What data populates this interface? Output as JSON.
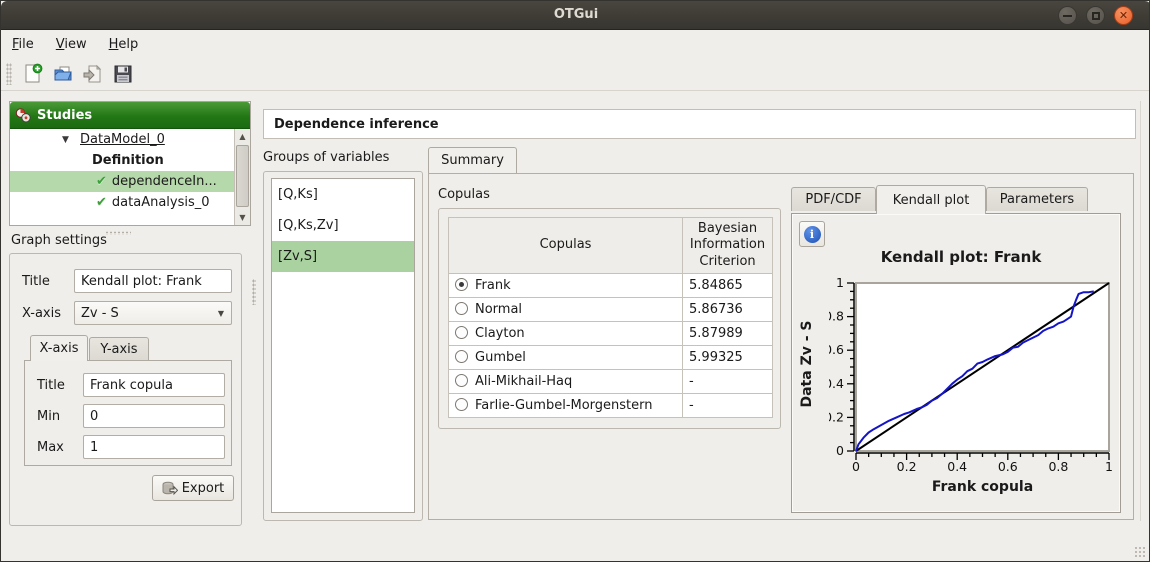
{
  "window": {
    "title": "OTGui"
  },
  "menu": {
    "items": [
      "File",
      "View",
      "Help"
    ]
  },
  "toolbar": {
    "buttons": [
      "new-study",
      "open-study",
      "import-python-script",
      "save"
    ]
  },
  "studies_panel": {
    "header": "Studies",
    "tree": {
      "root": {
        "label": "DataModel_0",
        "expanded": true
      },
      "children": [
        {
          "label": "Definition"
        },
        {
          "label": "dependenceIn...",
          "checked": true,
          "selected": true
        },
        {
          "label": "dataAnalysis_0",
          "checked": true
        }
      ]
    }
  },
  "graph_settings": {
    "section_label": "Graph settings",
    "title_label": "Title",
    "title_value": "Kendall plot: Frank",
    "xaxis_label": "X-axis",
    "xaxis_value": "Zv - S",
    "tabs": {
      "xaxis": "X-axis",
      "yaxis": "Y-axis",
      "selected": "X-axis"
    },
    "axis_title_label": "Title",
    "axis_title_value": "Frank copula",
    "min_label": "Min",
    "min_value": "0",
    "max_label": "Max",
    "max_value": "1",
    "export_label": "Export"
  },
  "main": {
    "header": "Dependence inference",
    "groups_label": "Groups of variables",
    "groups": [
      "[Q,Ks]",
      "[Q,Ks,Zv]",
      "[Zv,S]"
    ],
    "groups_selected_index": 2,
    "summary_tab": "Summary",
    "copulas_label": "Copulas",
    "table": {
      "col1": "Copulas",
      "col2": "Bayesian\nInformation\nCriterion",
      "rows": [
        {
          "name": "Frank",
          "bic": "5.84865",
          "selected": true
        },
        {
          "name": "Normal",
          "bic": "5.86736",
          "selected": false
        },
        {
          "name": "Clayton",
          "bic": "5.87989",
          "selected": false
        },
        {
          "name": "Gumbel",
          "bic": "5.99325",
          "selected": false
        },
        {
          "name": "Ali-Mikhail-Haq",
          "bic": "-",
          "selected": false
        },
        {
          "name": "Farlie-Gumbel-Morgenstern",
          "bic": "-",
          "selected": false
        }
      ]
    },
    "right_tabs": {
      "pdfcdf": "PDF/CDF",
      "kendall": "Kendall plot",
      "parameters": "Parameters",
      "selected": "Kendall plot"
    }
  },
  "chart_data": {
    "type": "line",
    "title": "Kendall plot: Frank",
    "xlabel": "Frank copula",
    "ylabel": "Data Zv - S",
    "xlim": [
      0,
      1
    ],
    "ylim": [
      0,
      1
    ],
    "ticks": [
      0,
      0.2,
      0.4,
      0.6,
      0.8,
      1
    ],
    "tick_labels": [
      "0",
      "0.2",
      "0.4",
      "0.6",
      "0.8",
      "1"
    ],
    "minor_tick_step": 0.05,
    "grid": false,
    "legend": "none",
    "series": [
      {
        "name": "reference-diagonal",
        "color": "#000000",
        "width": 2,
        "x": [
          0,
          1
        ],
        "y": [
          0,
          1
        ]
      },
      {
        "name": "empirical-kendall-curve",
        "color": "#1414c8",
        "width": 2,
        "x": [
          0,
          0.01,
          0.03,
          0.05,
          0.07,
          0.1,
          0.13,
          0.16,
          0.19,
          0.21,
          0.24,
          0.26,
          0.28,
          0.3,
          0.32,
          0.34,
          0.36,
          0.38,
          0.4,
          0.42,
          0.44,
          0.46,
          0.48,
          0.5,
          0.52,
          0.55,
          0.58,
          0.6,
          0.62,
          0.64,
          0.66,
          0.68,
          0.7,
          0.72,
          0.74,
          0.76,
          0.78,
          0.8,
          0.82,
          0.84,
          0.85,
          0.86,
          0.87,
          0.88,
          0.9,
          0.92,
          0.94
        ],
        "y": [
          0,
          0.04,
          0.08,
          0.11,
          0.13,
          0.155,
          0.18,
          0.2,
          0.22,
          0.23,
          0.25,
          0.26,
          0.275,
          0.3,
          0.315,
          0.34,
          0.37,
          0.4,
          0.425,
          0.445,
          0.475,
          0.49,
          0.52,
          0.53,
          0.545,
          0.565,
          0.575,
          0.59,
          0.615,
          0.62,
          0.645,
          0.66,
          0.675,
          0.69,
          0.715,
          0.73,
          0.74,
          0.76,
          0.77,
          0.79,
          0.8,
          0.86,
          0.9,
          0.935,
          0.945,
          0.945,
          0.95
        ]
      }
    ]
  }
}
